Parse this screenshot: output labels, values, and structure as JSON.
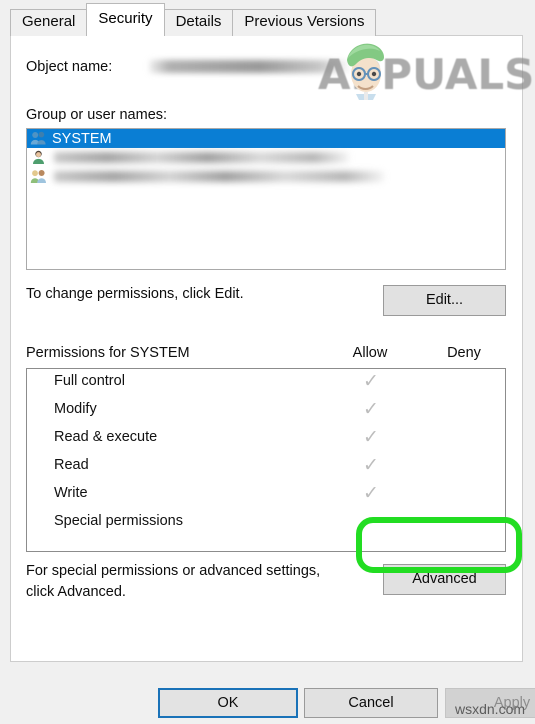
{
  "dialog": {
    "tabs": [
      {
        "label": "General",
        "active": false
      },
      {
        "label": "Security",
        "active": true
      },
      {
        "label": "Details",
        "active": false
      },
      {
        "label": "Previous Versions",
        "active": false
      }
    ],
    "object_name_label": "Object name:",
    "object_name_value": "",
    "group_users_label": "Group or user names:",
    "users": [
      {
        "name": "SYSTEM",
        "icon": "group-users-icon",
        "selected": true,
        "redacted": false
      },
      {
        "name": "",
        "icon": "single-user-icon",
        "selected": false,
        "redacted": true
      },
      {
        "name": "",
        "icon": "group-users-icon",
        "selected": false,
        "redacted": true
      }
    ],
    "edit_hint": "To change permissions, click Edit.",
    "edit_button_label": "Edit...",
    "permissions_title": "Permissions for SYSTEM",
    "allow_header": "Allow",
    "deny_header": "Deny",
    "permissions": [
      {
        "name": "Full control",
        "allow": true,
        "deny": false
      },
      {
        "name": "Modify",
        "allow": true,
        "deny": false
      },
      {
        "name": "Read & execute",
        "allow": true,
        "deny": false
      },
      {
        "name": "Read",
        "allow": true,
        "deny": false
      },
      {
        "name": "Write",
        "allow": true,
        "deny": false
      },
      {
        "name": "Special permissions",
        "allow": false,
        "deny": false
      }
    ],
    "advanced_hint_line1": "For special permissions or advanced settings,",
    "advanced_hint_line2": "click Advanced.",
    "advanced_button_label": "Advanced",
    "footer": {
      "ok_label": "OK",
      "cancel_label": "Cancel",
      "apply_label": "Apply",
      "apply_disabled": true
    }
  },
  "annotation": {
    "highlight_color": "#22dd22",
    "target": "advanced-button"
  },
  "watermarks": {
    "brand": "APPUALS",
    "site": "wsxdn.com"
  },
  "colors": {
    "selection_blue": "#0a7ed4",
    "dialog_gray": "#f0f0f0",
    "check_gray": "#bdbdbd",
    "focus_blue": "#1a72b8"
  },
  "glyphs": {
    "check": "✓"
  }
}
